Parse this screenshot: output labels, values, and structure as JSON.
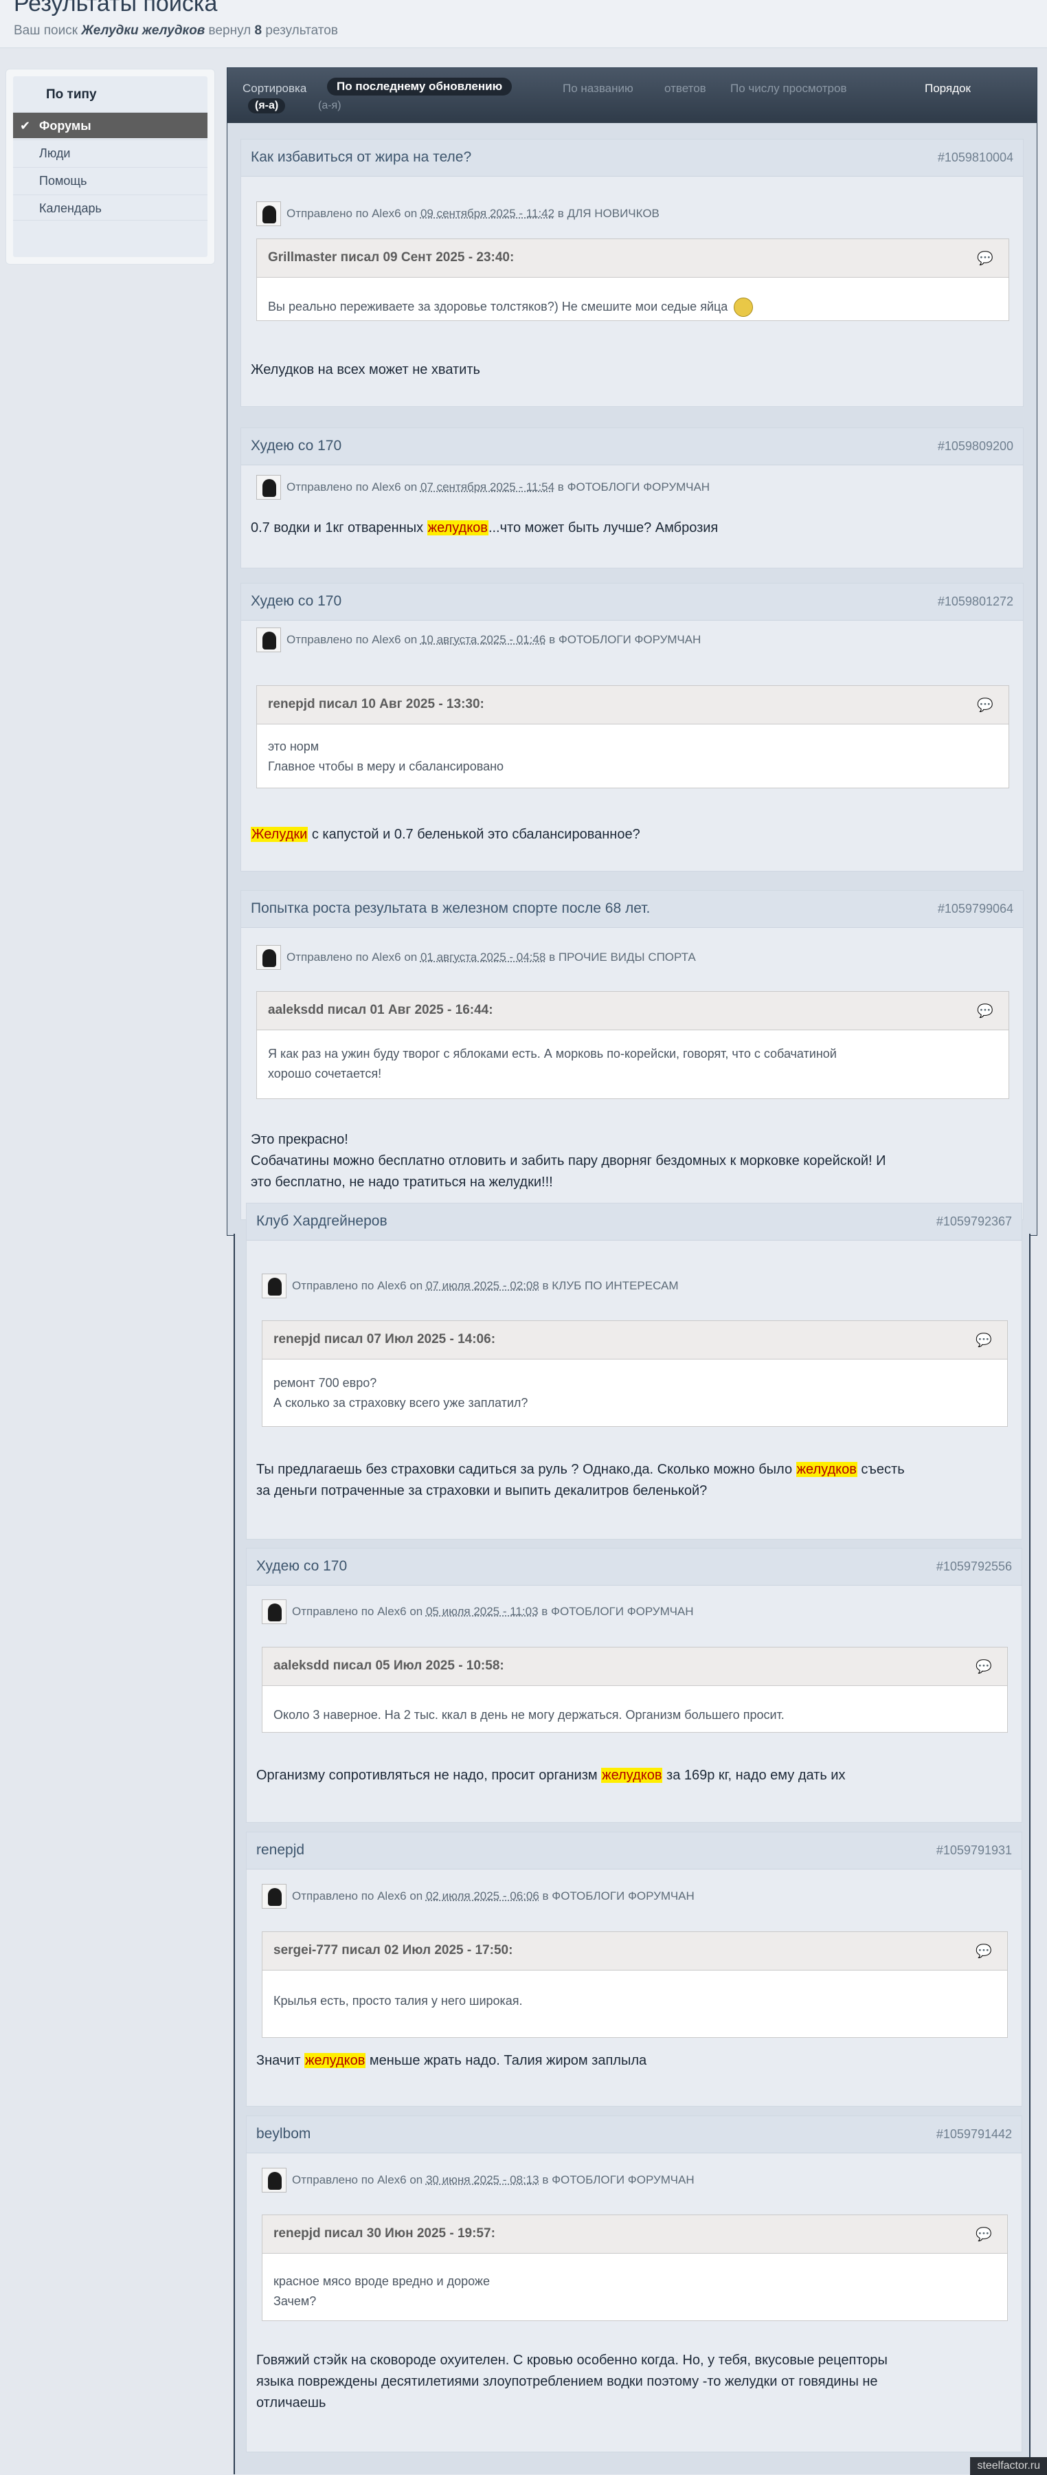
{
  "header": {
    "title": "Результаты поиска",
    "summary_prefix": "Ваш поиск ",
    "query": "Желудки желудков",
    "summary_mid": " вернул ",
    "count": "8",
    "summary_suffix": " результатов"
  },
  "sidebar": {
    "heading": "По типу",
    "items": [
      {
        "label": "Форумы",
        "active": true
      },
      {
        "label": "Люди"
      },
      {
        "label": "Помощь"
      },
      {
        "label": "Календарь"
      }
    ]
  },
  "sort": {
    "label": "Сортировка",
    "active": "По последнему обновлению",
    "options": [
      "По названию",
      "ответов",
      "По числу просмотров"
    ],
    "order_label": "Порядок",
    "dir_active": "(я-а)",
    "dir_other": "(а-я)"
  },
  "posts": [
    {
      "title": "Как избавиться от жира на теле?",
      "id": "#1059810004",
      "meta_prefix": "Отправлено по Alex6 on ",
      "date": "09 сентября 2025 - 11:42",
      "meta_in": " в ",
      "forum": "ДЛЯ НОВИЧКОВ",
      "quote_author": "Grillmaster писал 09 Сент 2025 - 23:40:",
      "quote_lines": [
        "Вы реально переживаете за здоровье толстяков?) Не смешите мои седые яйца"
      ],
      "text_lines": [
        [
          "Желудков на всех может не хватить"
        ]
      ]
    },
    {
      "title": "Худею со 170",
      "id": "#1059809200",
      "meta_prefix": "Отправлено по Alex6 on ",
      "date": "07 сентября 2025 - 11:54",
      "meta_in": " в ",
      "forum": "ФОТОБЛОГИ ФОРУМЧАН",
      "text_lines": [
        [
          "0.7 водки и 1кг отваренных ",
          "желудков",
          "...что может быть лучше? Амброзия"
        ]
      ]
    },
    {
      "title": "Худею со 170",
      "id": "#1059801272",
      "meta_prefix": "Отправлено по Alex6 on ",
      "date": "10 августа 2025 - 01:46",
      "meta_in": " в ",
      "forum": "ФОТОБЛОГИ ФОРУМЧАН",
      "quote_author": "renepjd писал 10 Авг 2025 - 13:30:",
      "quote_lines": [
        "это норм",
        "Главное чтобы в меру и сбалансировано"
      ],
      "text_lines": [
        [
          "",
          "Желудки",
          " с капустой и 0.7 беленькой это сбалансированное?"
        ]
      ]
    },
    {
      "title": "Попытка роста результата в железном спорте после 68 лет.",
      "id": "#1059799064",
      "meta_prefix": "Отправлено по Alex6 on ",
      "date": "01 августа 2025 - 04:58",
      "meta_in": " в ",
      "forum": "ПРОЧИЕ ВИДЫ СПОРТА",
      "quote_author": "aaleksdd писал 01 Авг 2025 - 16:44:",
      "quote_lines": [
        "Я как раз на ужин буду творог с яблоками есть. А морковь по-корейски, говорят, что с собачатиной",
        "хорошо сочетается!"
      ],
      "text_lines": [
        [
          "Это прекрасно!"
        ],
        [
          "Собачатины можно бесплатно отловить и забить пару дворняг бездомных к морковке корейской! И"
        ],
        [
          "это бесплатно, не надо тратиться на желудки!!!"
        ]
      ]
    },
    {
      "title": "Клуб Хардгейнеров",
      "id": "#1059792367",
      "meta_prefix": "Отправлено по Alex6 on ",
      "date": "07 июля 2025 - 02:08",
      "meta_in": " в ",
      "forum": "КЛУБ ПО ИНТЕРЕСАМ",
      "quote_author": "renepjd писал 07 Июл 2025 - 14:06:",
      "quote_lines": [
        "ремонт 700 евро?",
        "А сколько за страховку всего уже заплатил?"
      ],
      "text_lines": [
        [
          "Ты предлагаешь без страховки садиться за руль ? Однако,да. Сколько можно было ",
          "желудков",
          " съесть"
        ],
        [
          "за деньги потраченные за страховки и выпить декалитров беленькой?"
        ]
      ]
    },
    {
      "title": "Худею со 170",
      "id": "#1059792556",
      "meta_prefix": "Отправлено по Alex6 on ",
      "date": "05 июля 2025 - 11:03",
      "meta_in": " в ",
      "forum": "ФОТОБЛОГИ ФОРУМЧАН",
      "quote_author": "aaleksdd писал 05 Июл 2025 - 10:58:",
      "quote_lines": [
        "Около 3 наверное. На 2 тыс. ккал в день не могу держаться. Организм большего просит."
      ],
      "text_lines": [
        [
          "Организму сопротивляться не надо, просит организм ",
          "желудков",
          " за 169р кг, надо ему дать их"
        ]
      ]
    },
    {
      "title": "renepjd",
      "id": "#1059791931",
      "meta_prefix": "Отправлено по Alex6 on ",
      "date": "02 июля 2025 - 06:06",
      "meta_in": " в ",
      "forum": "ФОТОБЛОГИ ФОРУМЧАН",
      "quote_author": "sergei-777 писал 02 Июл 2025 - 17:50:",
      "quote_lines": [
        "",
        "Крылья есть, просто талия у него широкая."
      ],
      "text_lines": [
        [
          "Значит ",
          "желудков",
          " меньше жрать надо. Талия жиром заплыла"
        ]
      ]
    },
    {
      "title": "beylbom",
      "id": "#1059791442",
      "meta_prefix": "Отправлено по Alex6 on ",
      "date": "30 июня 2025 - 08:13",
      "meta_in": " в ",
      "forum": "ФОТОБЛОГИ ФОРУМЧАН",
      "quote_author": "renepjd писал 30 Июн 2025 - 19:57:",
      "quote_lines": [
        "красное мясо вроде вредно и дороже",
        "Зачем?"
      ],
      "text_lines": [
        [
          "Говяжий стэйк на сковороде охуителен. С кровью особенно когда. Но, у тебя, вкусовые рецепторы"
        ],
        [
          "языка повреждены десятилетиями злоупотреблением  водки поэтому -то желудки от говядины не"
        ],
        [
          "отличаешь"
        ]
      ]
    }
  ],
  "watermark": "steelfactor.ru"
}
